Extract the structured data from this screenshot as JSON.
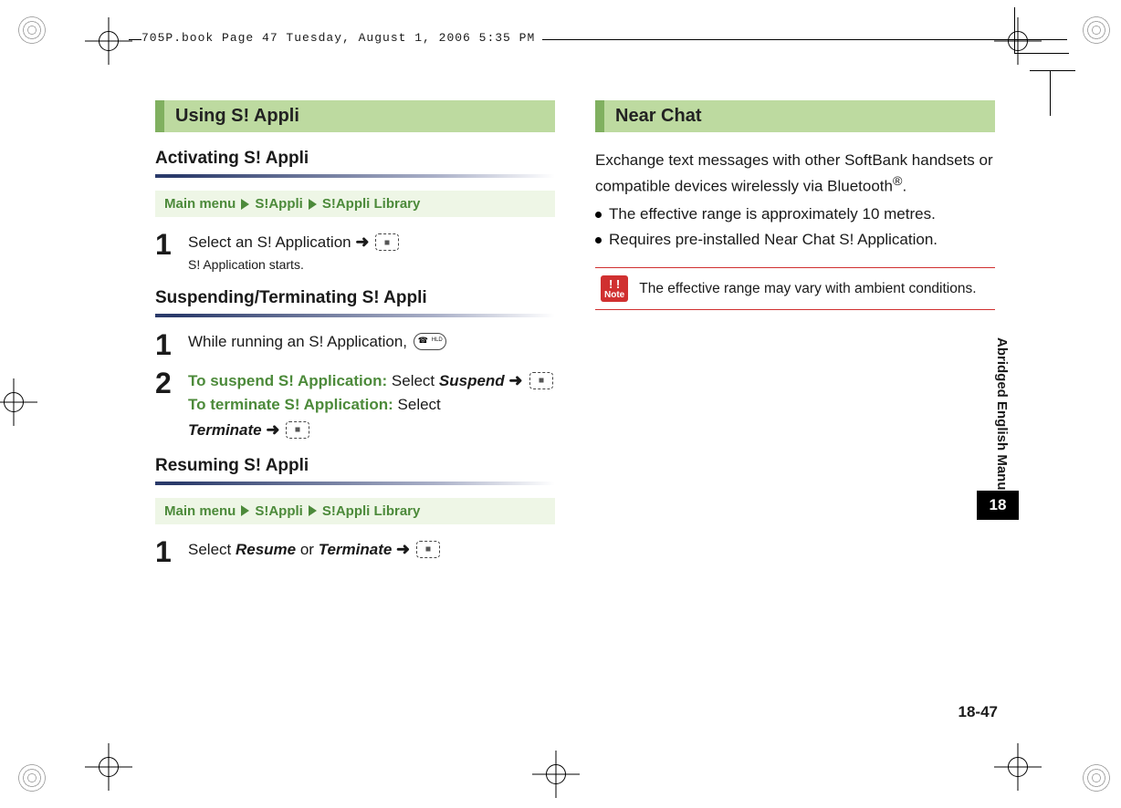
{
  "header": "705P.book  Page 47  Tuesday, August 1, 2006  5:35 PM",
  "left": {
    "section": "Using S! Appli",
    "sub1": "Activating S! Appli",
    "bc": {
      "a": "Main menu",
      "b": "S!Appli",
      "c": "S!Appli Library"
    },
    "s1_text": "Select an S! Application",
    "s1_sub": "S! Application starts.",
    "sub2": "Suspending/Terminating S! Appli",
    "s2_text": "While running an S! Application,",
    "s3_susp_label": "To suspend S! Application:",
    "s3_susp_sel": "Select ",
    "s3_susp_item": "Suspend",
    "s3_term_label": "To terminate S! Application:",
    "s3_term_sel": "Select ",
    "s3_term_item": "Terminate",
    "sub3": "Resuming S! Appli",
    "s4_sel": "Select ",
    "s4_a": "Resume",
    "s4_or": " or ",
    "s4_b": "Terminate"
  },
  "right": {
    "section": "Near Chat",
    "p1a": "Exchange text messages with other SoftBank handsets or compatible devices wirelessly via Bluetooth",
    "p1b": ".",
    "b1": "The effective range is approximately 10 metres.",
    "b2": "Requires pre-installed Near Chat S! Application.",
    "note_label": "Note",
    "note_text": "The effective range may vary with ambient conditions."
  },
  "sidebar": "Abridged English Manual",
  "chapter": "18",
  "page_number": "18-47"
}
